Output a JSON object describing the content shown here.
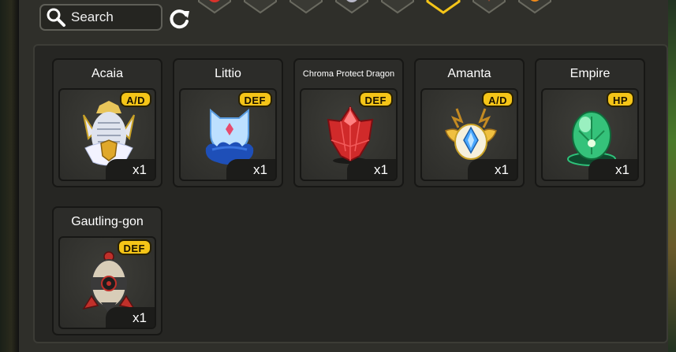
{
  "search": {
    "label": "Search"
  },
  "cards": [
    {
      "name": "Acaia",
      "badge": "A/D",
      "count": "x1"
    },
    {
      "name": "Littio",
      "badge": "DEF",
      "count": "x1"
    },
    {
      "name": "Chroma Protect Dragon",
      "badge": "DEF",
      "count": "x1"
    },
    {
      "name": "Amanta",
      "badge": "A/D",
      "count": "x1"
    },
    {
      "name": "Empire",
      "badge": "HP",
      "count": "x1"
    },
    {
      "name": "Gautling-gon",
      "badge": "DEF",
      "count": "x1"
    }
  ],
  "colors": {
    "badge": "#f5c518",
    "selected_tab": "#f5c518",
    "panel": "#262623"
  },
  "filter_tabs": [
    "red-element-icon",
    "yellow-element-icon",
    "blue-element-icon",
    "silver-element-icon",
    "dark-element-icon",
    "selected-element-icon",
    "brown-element-icon",
    "orange-element-icon"
  ]
}
